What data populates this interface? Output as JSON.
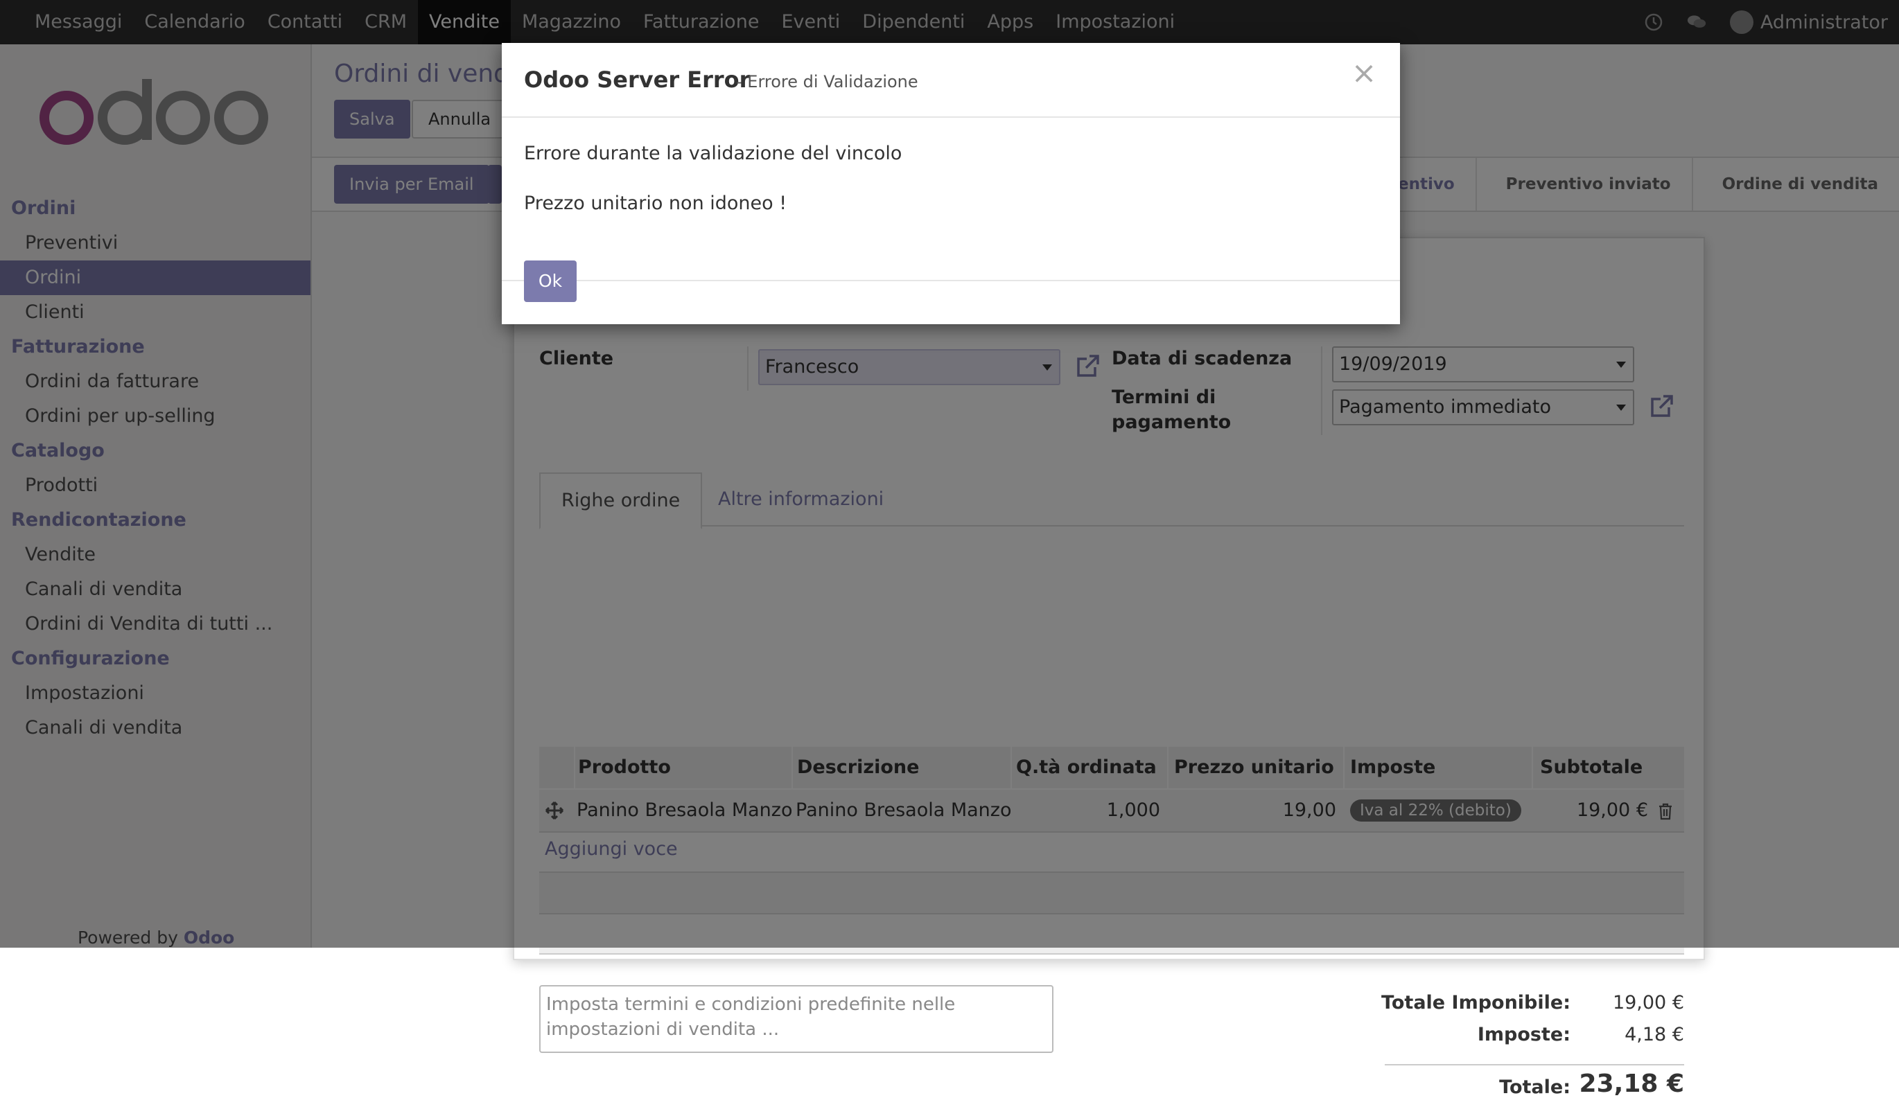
{
  "navbar": {
    "menu": [
      "Messaggi",
      "Calendario",
      "Contatti",
      "CRM",
      "Vendite",
      "Magazzino",
      "Fatturazione",
      "Eventi",
      "Dipendenti",
      "Apps",
      "Impostazioni"
    ],
    "active_index": 4,
    "user": "Administrator"
  },
  "sidebar": {
    "logo": "odoo",
    "sections": [
      {
        "title": "Ordini",
        "items": [
          "Preventivi",
          "Ordini",
          "Clienti"
        ]
      },
      {
        "title": "Fatturazione",
        "items": [
          "Ordini da fatturare",
          "Ordini per up-selling"
        ]
      },
      {
        "title": "Catalogo",
        "items": [
          "Prodotti"
        ]
      },
      {
        "title": "Rendicontazione",
        "items": [
          "Vendite",
          "Canali di vendita",
          "Ordini di Vendita di tutti ..."
        ]
      },
      {
        "title": "Configurazione",
        "items": [
          "Impostazioni",
          "Canali di vendita"
        ]
      }
    ],
    "active_item": "Ordini",
    "powered_prefix": "Powered by",
    "powered_brand": "Odoo"
  },
  "main": {
    "title": "Ordini di vend",
    "save_label": "Salva",
    "discard_label": "Annulla",
    "email_label": "Invia per Email",
    "status_steps": [
      "Preventivo",
      "Preventivo inviato",
      "Ordine di vendita"
    ],
    "current_step_index": 0
  },
  "form": {
    "customer_label": "Cliente",
    "customer_value": "Francesco",
    "due_date_label": "Data di scadenza",
    "due_date_value": "19/09/2019",
    "payment_terms_label": "Termini di pagamento",
    "payment_terms_value": "Pagamento immediato",
    "tabs": [
      "Righe ordine",
      "Altre informazioni"
    ],
    "active_tab": 0,
    "columns": [
      "Prodotto",
      "Descrizione",
      "Q.tà ordinata",
      "Prezzo unitario",
      "Imposte",
      "Subtotale"
    ],
    "lines": [
      {
        "product": "Panino Bresaola Manzo",
        "description": "Panino Bresaola Manzo",
        "qty": "1,000",
        "unit_price": "19,00",
        "tax": "Iva al 22% (debito)",
        "subtotal": "19,00 €"
      }
    ],
    "add_line_label": "Aggiungi voce",
    "notes_placeholder": "Imposta termini e condizioni predefinite nelle impostazioni di vendita ...",
    "untaxed_label": "Totale Imponibile:",
    "untaxed_value": "19,00 €",
    "taxes_label": "Imposte:",
    "taxes_value": "4,18 €",
    "total_label": "Totale:",
    "total_value": "23,18 €"
  },
  "modal": {
    "title": "Odoo Server Error",
    "subtitle": "- Errore di Validazione",
    "message_line1": "Errore durante la validazione del vincolo",
    "message_line2": "Prezzo unitario non idoneo !",
    "ok_label": "Ok"
  },
  "colors": {
    "brand": "#7c7bad",
    "navbar_bg": "#2e2e2e",
    "sidebar_bg": "#f0eeee"
  }
}
